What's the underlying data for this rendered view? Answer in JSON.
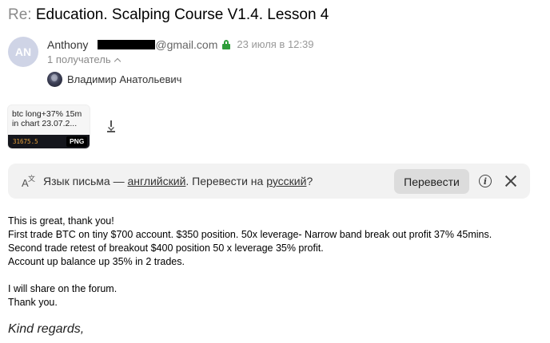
{
  "subject": {
    "prefix": "Re:",
    "title": "Education. Scalping Course V1.4. Lesson 4"
  },
  "sender": {
    "avatar_initials": "AN",
    "avatar_color": "#cfd4e6",
    "name": "Anthony",
    "email_domain": "@gmail.com",
    "secure_icon": "lock-icon",
    "secure_color": "#2e9e3a",
    "date": "23 июля в 12:39"
  },
  "recipients": {
    "summary": "1 получатель",
    "items": [
      {
        "name": "Владимир Анатольевич"
      }
    ]
  },
  "attachment": {
    "name": "btc long+37% 15m\nin chart 23.07.2...",
    "thumb_price": "31675.5",
    "type_badge": "PNG",
    "download_icon": "download-icon"
  },
  "translate_bar": {
    "text_before": "Язык письма — ",
    "source_lang": "английский",
    "text_middle": ". Перевести на ",
    "target_lang": "русский",
    "text_after": "?",
    "button_label": "Перевести",
    "info_icon": "info-icon",
    "close_icon": "close-icon"
  },
  "body": {
    "lines": [
      "This is great, thank you!",
      "First trade BTC on tiny $700 account. $350 position. 50x leverage- Narrow band break out profit 37% 45mins.",
      "Second trade retest of breakout $400 position 50 x leverage 35% profit.",
      "Account up balance up 35% in 2 trades.",
      "",
      "I will share on the forum.",
      "Thank you."
    ],
    "signoff": "Kind regards,"
  }
}
